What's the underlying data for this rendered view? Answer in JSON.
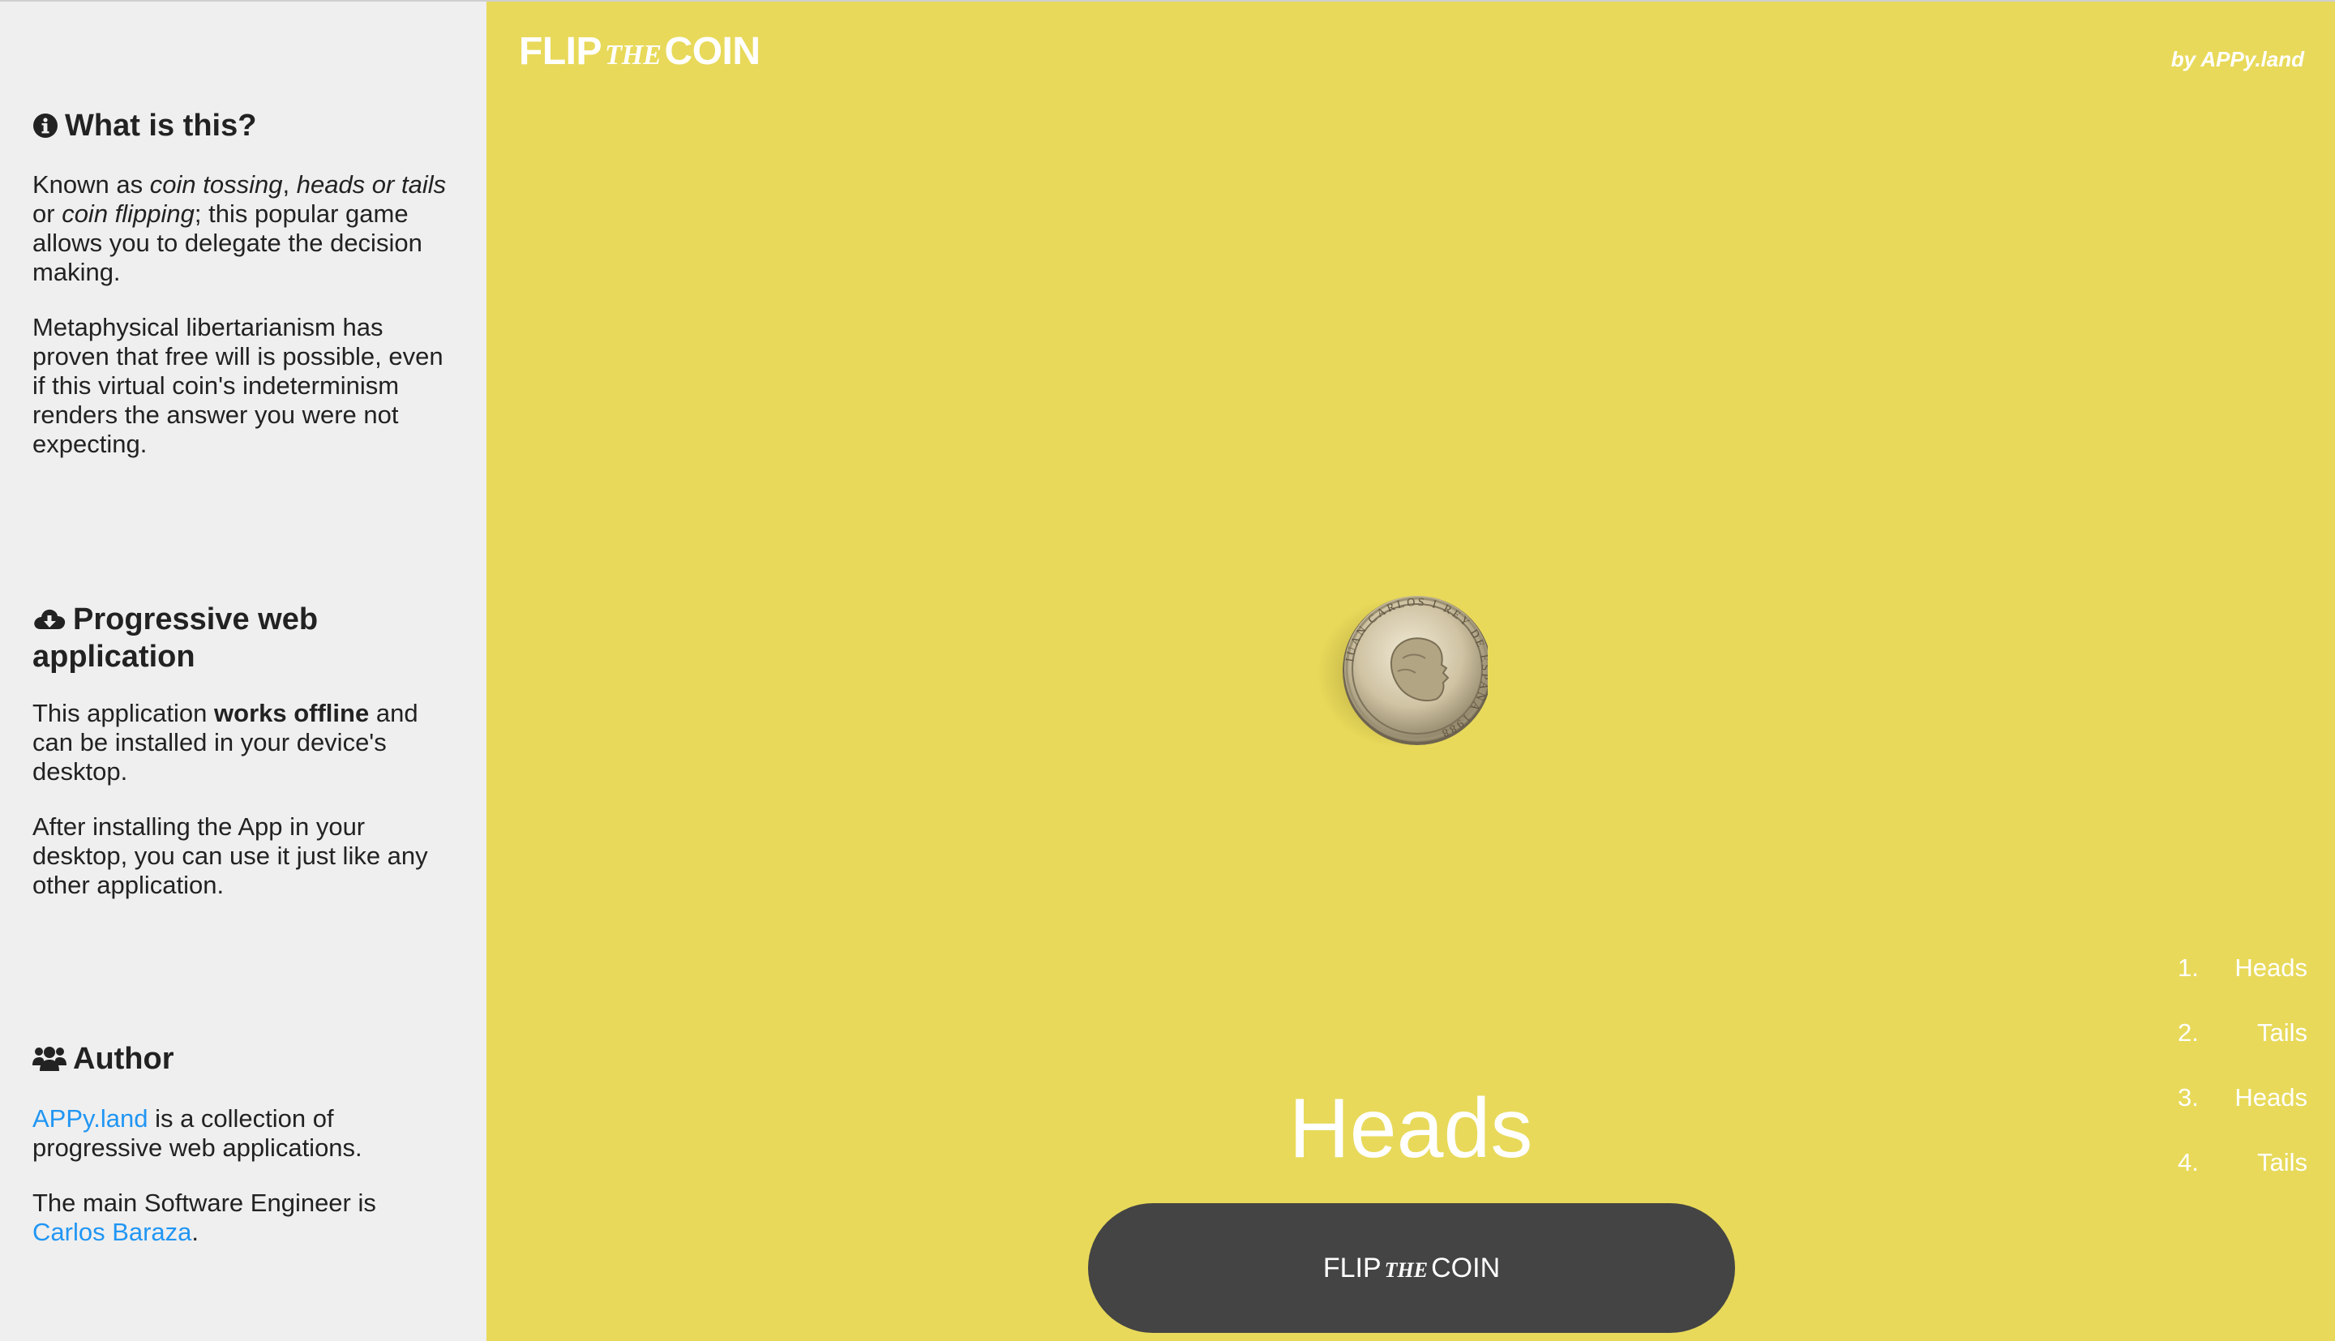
{
  "sidebar": {
    "about": {
      "heading": "What is this?",
      "p1": {
        "t1": "Known as ",
        "e1": "coin tossing",
        "t2": ", ",
        "e2": "heads or tails",
        "t3": " or ",
        "e3": "coin flipping",
        "t4": "; this popular game allows you to delegate the decision making."
      },
      "p2": "Metaphysical libertarianism has proven that free will is possible, even if this virtual coin's indeterminism renders the answer you were not expecting."
    },
    "pwa": {
      "heading": "Progressive web application",
      "p1": {
        "t1": "This application ",
        "b1": "works offline",
        "t2": " and can be installed in your device's desktop."
      },
      "p2": "After installing the App in your desktop, you can use it just like any other application."
    },
    "author": {
      "heading": "Author",
      "p1": {
        "link": "APPy.land",
        "t1": " is a collection of progressive web applications."
      },
      "p2": {
        "t1": "The main Software Engineer is ",
        "link": "Carlos Baraza",
        "t2": "."
      }
    }
  },
  "header": {
    "brand": {
      "part1": "FLIP",
      "part2": "THE",
      "part3": "COIN"
    },
    "byline": "by APPy.land"
  },
  "coin": {
    "icon": "coin-image",
    "inscription": "IUAN CARLOS I REY DE ESPAÑA 1988"
  },
  "result": "Heads",
  "button": {
    "part1": "FLIP",
    "part2": "THE",
    "part3": "COIN"
  },
  "history": [
    {
      "num": "1.",
      "value": "Heads"
    },
    {
      "num": "2.",
      "value": "Tails"
    },
    {
      "num": "3.",
      "value": "Heads"
    },
    {
      "num": "4.",
      "value": "Tails"
    }
  ],
  "colors": {
    "background": "#e8d95a",
    "sidebar": "#efefef",
    "button": "#444444",
    "link": "#2196f3",
    "text_light": "#ffffff"
  },
  "icons": {
    "about": "info-circle-icon",
    "pwa": "cloud-download-icon",
    "author": "users-icon"
  }
}
